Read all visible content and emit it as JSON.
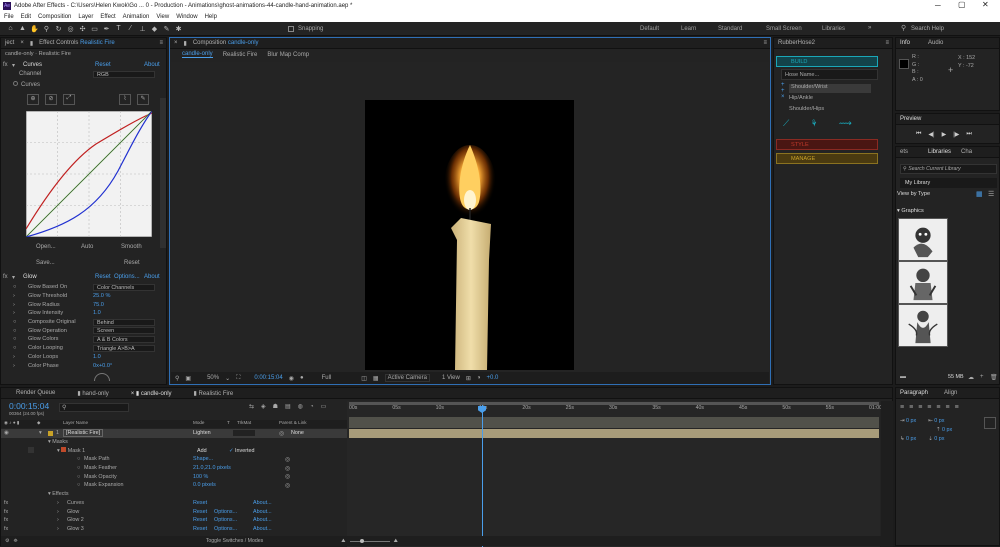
{
  "window": {
    "title": "Adobe After Effects - C:\\Users\\Helen Kwok\\Go ... 0 - Production - Animations\\ghost-animations-44-candle-hand-animation.aep *"
  },
  "menu": [
    "File",
    "Edit",
    "Composition",
    "Layer",
    "Effect",
    "Animation",
    "View",
    "Window",
    "Help"
  ],
  "toolbar": {
    "snapping": "Snapping",
    "workspaces": [
      "Default",
      "Learn",
      "Standard",
      "Small Screen",
      "Libraries"
    ],
    "active_workspace": "Standard",
    "search": "Search Help"
  },
  "effect_controls": {
    "tab_prefix": "ject",
    "tab": "Effect Controls",
    "layer": "Realistic Fire",
    "subtitle": "candle-only · Realistic Fire",
    "curves": {
      "name": "Curves",
      "reset": "Reset",
      "about": "About",
      "channel_label": "Channel",
      "channel_value": "RGB",
      "curves_label": "Curves",
      "open": "Open...",
      "auto": "Auto",
      "smooth": "Smooth",
      "save": "Save...",
      "reset_btn": "Reset"
    },
    "glow": {
      "name": "Glow",
      "reset": "Reset",
      "options": "Options...",
      "about": "About",
      "props": [
        {
          "label": "Glow Based On",
          "value": "Color Channels",
          "kind": "dd"
        },
        {
          "label": "Glow Threshold",
          "value": "25.0 %",
          "kind": "num"
        },
        {
          "label": "Glow Radius",
          "value": "75.0",
          "kind": "num"
        },
        {
          "label": "Glow Intensity",
          "value": "1.0",
          "kind": "num"
        },
        {
          "label": "Composite Original",
          "value": "Behind",
          "kind": "dd"
        },
        {
          "label": "Glow Operation",
          "value": "Screen",
          "kind": "dd"
        },
        {
          "label": "Glow Colors",
          "value": "A & B Colors",
          "kind": "dd"
        },
        {
          "label": "Color Looping",
          "value": "Triangle A>B>A",
          "kind": "dd"
        },
        {
          "label": "Color Loops",
          "value": "1.0",
          "kind": "num"
        },
        {
          "label": "Color Phase",
          "value": "0x+0.0°",
          "kind": "num"
        }
      ]
    }
  },
  "composition": {
    "tab": "Composition",
    "comp_name": "candle-only",
    "breadcrumbs": [
      "candle-only",
      "Realistic Fire",
      "Blur Map Comp"
    ],
    "zoom": "50%",
    "timecode": "0:00:15:04",
    "resolution": "Full",
    "camera": "Active Camera",
    "view": "1 View",
    "exposure": "+0.0"
  },
  "rubberhose": {
    "title": "RubberHose2",
    "build": "BUILD",
    "hose_name": "Hose Name...",
    "items": [
      "Shoulder/Wrist",
      "Hip/Ankle",
      "Shoulder/Hips"
    ],
    "style": "STYLE",
    "manage": "MANAGE"
  },
  "info": {
    "tabs": [
      "Info",
      "Audio"
    ],
    "rgb": [
      "R :",
      "G :",
      "B :",
      "A : 0"
    ],
    "x": "X : 152",
    "y": "Y : -72"
  },
  "preview": {
    "title": "Preview"
  },
  "libraries": {
    "tabs": [
      "ets",
      "Libraries",
      "Cha"
    ],
    "search": "Search Current Library",
    "library": "My Library",
    "view_by": "View by Type",
    "section": "Graphics",
    "size": "55 MB"
  },
  "timeline": {
    "tabs": [
      "Render Queue",
      "hand-only",
      "candle-only",
      "Realistic Fire"
    ],
    "active_tab": "candle-only",
    "timecode": "0:00:15:04",
    "fps": "00364 (24.00 fps)",
    "columns": [
      "Layer Name",
      "Mode",
      "T",
      "TrkMat",
      "Parent & Link"
    ],
    "ruler": [
      "00s",
      "05s",
      "10s",
      "15s",
      "20s",
      "25s",
      "30s",
      "35s",
      "40s",
      "45s",
      "50s",
      "55s",
      "01:00"
    ],
    "layer": {
      "num": "1",
      "name": "[Realistic Fire]",
      "mode": "Lighten",
      "parent": "None"
    },
    "masks_label": "Masks",
    "mask_name": "Mask 1",
    "mask_mode": "Add",
    "inverted": "Inverted",
    "mask_props": [
      {
        "label": "Mask Path",
        "value": "Shape..."
      },
      {
        "label": "Mask Feather",
        "value": "21.0,21.0 pixels"
      },
      {
        "label": "Mask Opacity",
        "value": "100 %"
      },
      {
        "label": "Mask Expansion",
        "value": "0.0 pixels"
      }
    ],
    "effects_label": "Effects",
    "effects": [
      {
        "name": "Curves",
        "reset": "Reset",
        "options": "",
        "about": "About..."
      },
      {
        "name": "Glow",
        "reset": "Reset",
        "options": "Options...",
        "about": "About..."
      },
      {
        "name": "Glow 2",
        "reset": "Reset",
        "options": "Options...",
        "about": "About..."
      },
      {
        "name": "Glow 3",
        "reset": "Reset",
        "options": "Options...",
        "about": "About..."
      }
    ],
    "toggle": "Toggle Switches / Modes"
  },
  "paragraph": {
    "tabs": [
      "Paragraph",
      "Align"
    ],
    "values": [
      "0 px",
      "0 px",
      "0 px",
      "0 px",
      "0 px"
    ]
  },
  "colors": {
    "accent": "#4a9eea",
    "hose_cyan": "#1aa7b8",
    "style_red": "#c0392b",
    "manage_yellow": "#c9a227"
  }
}
